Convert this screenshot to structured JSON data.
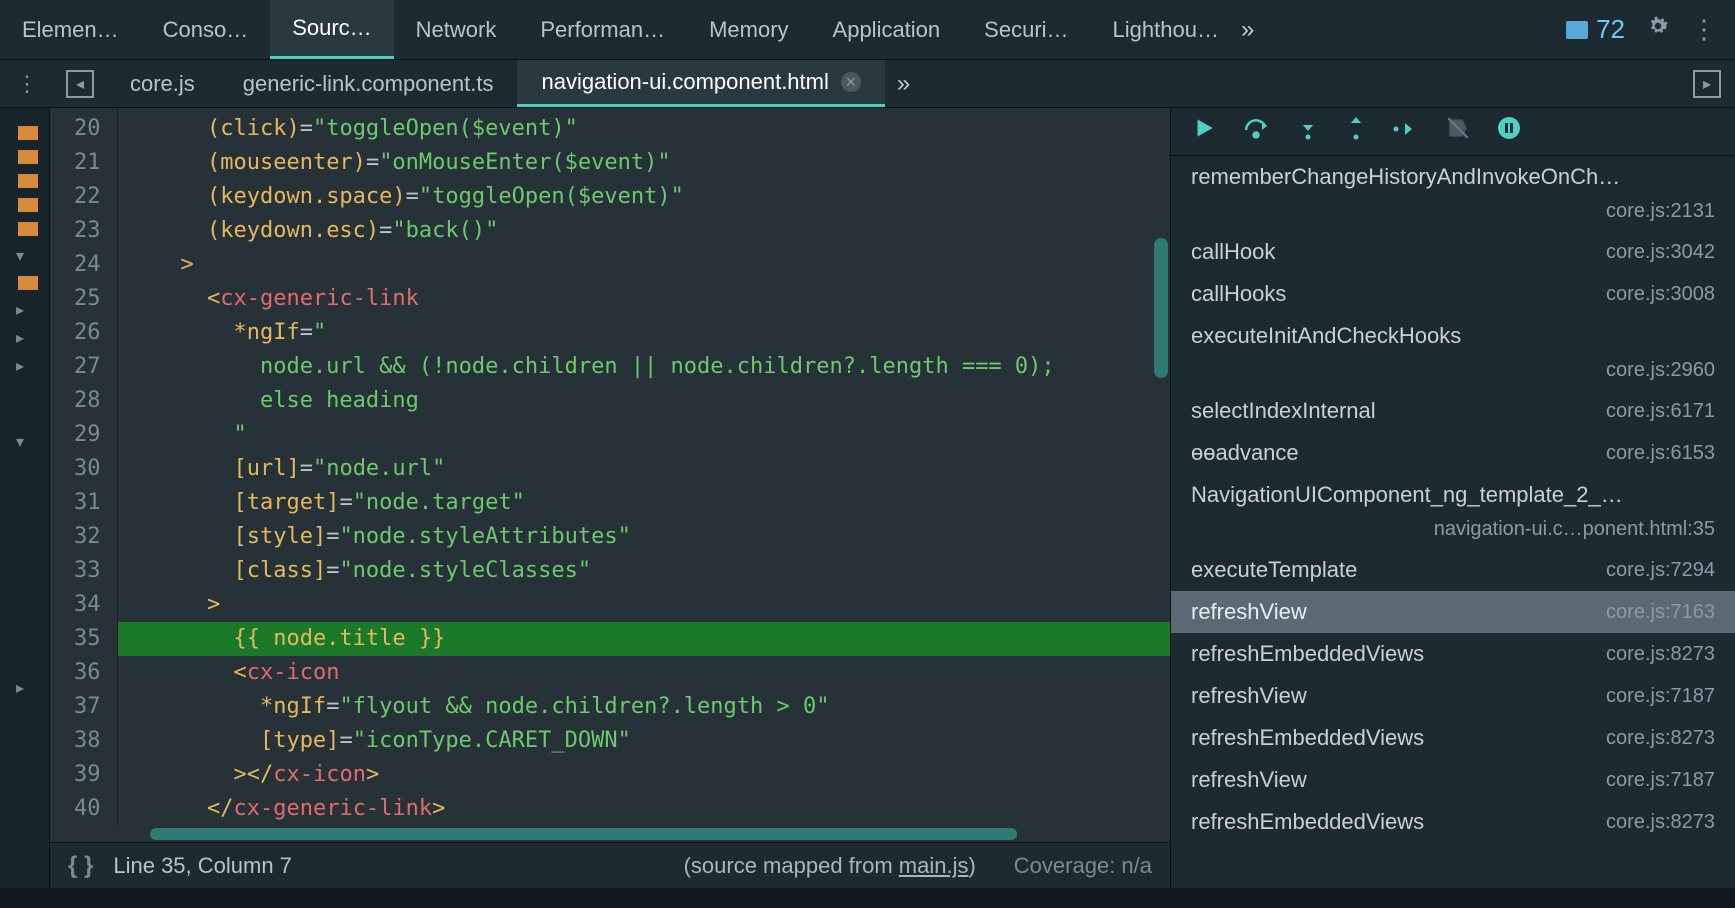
{
  "topTabs": [
    {
      "label": "Elemen…"
    },
    {
      "label": "Conso…"
    },
    {
      "label": "Sourc…",
      "active": true
    },
    {
      "label": "Network"
    },
    {
      "label": "Performan…"
    },
    {
      "label": "Memory"
    },
    {
      "label": "Application"
    },
    {
      "label": "Securi…"
    },
    {
      "label": "Lighthou…"
    }
  ],
  "issuesCount": "72",
  "fileTabs": [
    {
      "label": "core.js"
    },
    {
      "label": "generic-link.component.ts"
    },
    {
      "label": "navigation-ui.component.html",
      "active": true,
      "closable": true
    }
  ],
  "code": {
    "startLine": 20,
    "highlightLine": 35,
    "lines": [
      [
        {
          "c": "t-plain",
          "t": "      "
        },
        {
          "c": "t-attr",
          "t": "(click)"
        },
        {
          "c": "t-op",
          "t": "="
        },
        {
          "c": "t-str",
          "t": "\"toggleOpen($event)\""
        }
      ],
      [
        {
          "c": "t-plain",
          "t": "      "
        },
        {
          "c": "t-attr",
          "t": "(mouseenter)"
        },
        {
          "c": "t-op",
          "t": "="
        },
        {
          "c": "t-str",
          "t": "\"onMouseEnter($event)\""
        }
      ],
      [
        {
          "c": "t-plain",
          "t": "      "
        },
        {
          "c": "t-attr",
          "t": "(keydown.space)"
        },
        {
          "c": "t-op",
          "t": "="
        },
        {
          "c": "t-str",
          "t": "\"toggleOpen($event)\""
        }
      ],
      [
        {
          "c": "t-plain",
          "t": "      "
        },
        {
          "c": "t-attr",
          "t": "(keydown.esc)"
        },
        {
          "c": "t-op",
          "t": "="
        },
        {
          "c": "t-str",
          "t": "\"back()\""
        }
      ],
      [
        {
          "c": "t-plain",
          "t": "    "
        },
        {
          "c": "t-attr",
          "t": ">"
        }
      ],
      [
        {
          "c": "t-plain",
          "t": "      "
        },
        {
          "c": "t-attr",
          "t": "<"
        },
        {
          "c": "t-tag",
          "t": "cx-generic-link"
        }
      ],
      [
        {
          "c": "t-plain",
          "t": "        "
        },
        {
          "c": "t-attr",
          "t": "*ngIf"
        },
        {
          "c": "t-op",
          "t": "="
        },
        {
          "c": "t-str",
          "t": "\""
        }
      ],
      [
        {
          "c": "t-plain",
          "t": "          "
        },
        {
          "c": "t-str",
          "t": "node.url && (!node.children || node.children?.length === 0);"
        }
      ],
      [
        {
          "c": "t-plain",
          "t": "          "
        },
        {
          "c": "t-str",
          "t": "else heading"
        }
      ],
      [
        {
          "c": "t-plain",
          "t": "        "
        },
        {
          "c": "t-str",
          "t": "\""
        }
      ],
      [
        {
          "c": "t-plain",
          "t": "        "
        },
        {
          "c": "t-attr",
          "t": "[url]"
        },
        {
          "c": "t-op",
          "t": "="
        },
        {
          "c": "t-str",
          "t": "\"node.url\""
        }
      ],
      [
        {
          "c": "t-plain",
          "t": "        "
        },
        {
          "c": "t-attr",
          "t": "[target]"
        },
        {
          "c": "t-op",
          "t": "="
        },
        {
          "c": "t-str",
          "t": "\"node.target\""
        }
      ],
      [
        {
          "c": "t-plain",
          "t": "        "
        },
        {
          "c": "t-attr",
          "t": "[style]"
        },
        {
          "c": "t-op",
          "t": "="
        },
        {
          "c": "t-str",
          "t": "\"node.styleAttributes\""
        }
      ],
      [
        {
          "c": "t-plain",
          "t": "        "
        },
        {
          "c": "t-attr",
          "t": "[class]"
        },
        {
          "c": "t-op",
          "t": "="
        },
        {
          "c": "t-str",
          "t": "\"node.styleClasses\""
        }
      ],
      [
        {
          "c": "t-plain",
          "t": "      "
        },
        {
          "c": "t-attr",
          "t": ">"
        }
      ],
      [
        {
          "c": "t-plain",
          "t": "        "
        },
        {
          "c": "t-attr",
          "t": "{{ node.title }}"
        }
      ],
      [
        {
          "c": "t-plain",
          "t": "        "
        },
        {
          "c": "t-attr",
          "t": "<"
        },
        {
          "c": "t-tag",
          "t": "cx-icon"
        }
      ],
      [
        {
          "c": "t-plain",
          "t": "          "
        },
        {
          "c": "t-attr",
          "t": "*ngIf"
        },
        {
          "c": "t-op",
          "t": "="
        },
        {
          "c": "t-str",
          "t": "\"flyout && node.children?.length > 0\""
        }
      ],
      [
        {
          "c": "t-plain",
          "t": "          "
        },
        {
          "c": "t-attr",
          "t": "[type]"
        },
        {
          "c": "t-op",
          "t": "="
        },
        {
          "c": "t-str",
          "t": "\"iconType.CARET_DOWN\""
        }
      ],
      [
        {
          "c": "t-plain",
          "t": "        "
        },
        {
          "c": "t-attr",
          "t": "></"
        },
        {
          "c": "t-tag",
          "t": "cx-icon"
        },
        {
          "c": "t-attr",
          "t": ">"
        }
      ],
      [
        {
          "c": "t-plain",
          "t": "      "
        },
        {
          "c": "t-attr",
          "t": "</"
        },
        {
          "c": "t-tag",
          "t": "cx-generic-link"
        },
        {
          "c": "t-attr",
          "t": ">"
        }
      ],
      [
        {
          "c": "t-plain",
          "t": ""
        }
      ]
    ]
  },
  "status": {
    "position": "Line 35, Column 7",
    "sourceMapPrefix": "(source mapped from ",
    "sourceMapFile": "main.js",
    "sourceMapSuffix": ")",
    "coverage": "Coverage: n/a"
  },
  "callstack": [
    {
      "fn": "rememberChangeHistoryAndInvokeOnCh…",
      "loc": ""
    },
    {
      "fn": "",
      "loc": "core.js:2131",
      "right": true
    },
    {
      "fn": "callHook",
      "loc": "core.js:3042"
    },
    {
      "fn": "callHooks",
      "loc": "core.js:3008"
    },
    {
      "fn": "executeInitAndCheckHooks",
      "loc": ""
    },
    {
      "fn": "",
      "loc": "core.js:2960",
      "right": true
    },
    {
      "fn": "selectIndexInternal",
      "loc": "core.js:6171"
    },
    {
      "fn": "ɵɵadvance",
      "loc": "core.js:6153"
    },
    {
      "fn": "NavigationUIComponent_ng_template_2_…",
      "loc": ""
    },
    {
      "fn": "",
      "loc": "navigation-ui.c…ponent.html:35",
      "right": true
    },
    {
      "fn": "executeTemplate",
      "loc": "core.js:7294"
    },
    {
      "fn": "refreshView",
      "loc": "core.js:7163",
      "selected": true
    },
    {
      "fn": "refreshEmbeddedViews",
      "loc": "core.js:8273"
    },
    {
      "fn": "refreshView",
      "loc": "core.js:7187"
    },
    {
      "fn": "refreshEmbeddedViews",
      "loc": "core.js:8273"
    },
    {
      "fn": "refreshView",
      "loc": "core.js:7187"
    },
    {
      "fn": "refreshEmbeddedViews",
      "loc": "core.js:8273"
    }
  ]
}
